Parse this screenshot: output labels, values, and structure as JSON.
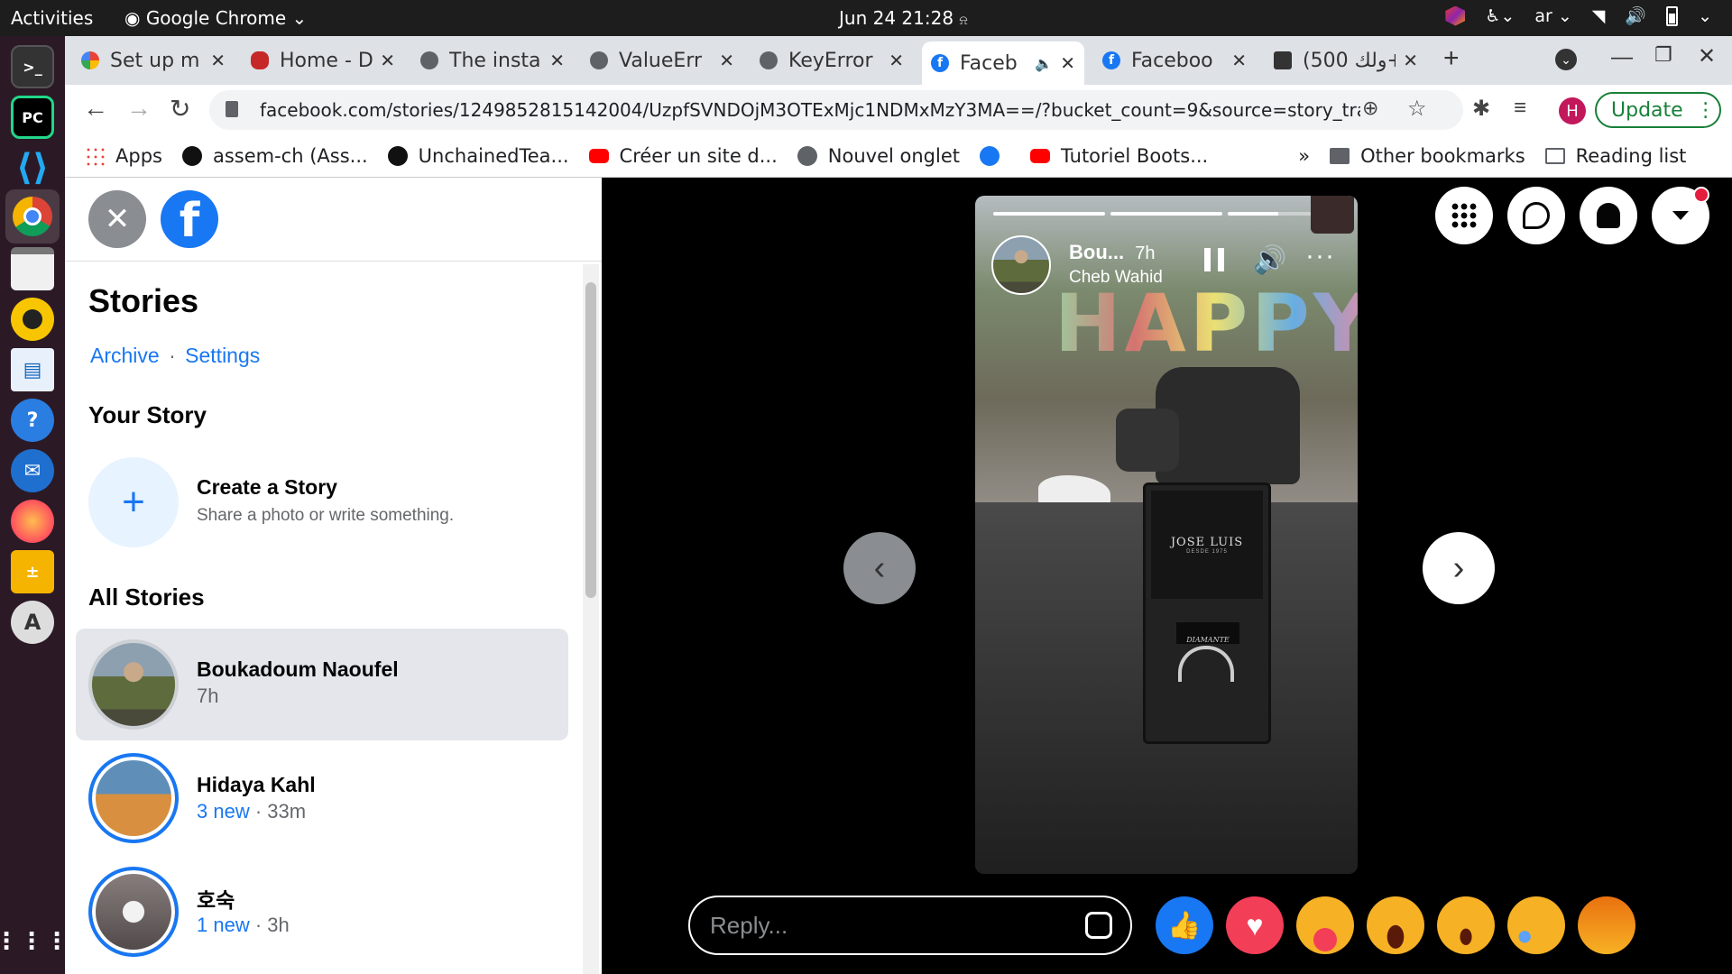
{
  "os": {
    "activities": "Activities",
    "app_name": "Google Chrome",
    "clock": "Jun 24  21:28",
    "lang": "ar"
  },
  "tabs": [
    {
      "title": "Set up m",
      "active": false
    },
    {
      "title": "Home - D",
      "active": false
    },
    {
      "title": "The insta",
      "active": false
    },
    {
      "title": "ValueErr",
      "active": false
    },
    {
      "title": "KeyError",
      "active": false
    },
    {
      "title": "Faceb",
      "active": true
    },
    {
      "title": "Faceboo",
      "active": false
    },
    {
      "title": "(ولك 500+",
      "active": false
    }
  ],
  "toolbar": {
    "url": "facebook.com/stories/1249852815142004/UzpfSVNDOjM3OTExMjc1NDMxMzY3MA==/?bucket_count=9&source=story_tray",
    "profile_initial": "H",
    "update_label": "Update"
  },
  "bookmarks": [
    {
      "label": "Apps",
      "icon": "apps-grid-icon"
    },
    {
      "label": "assem-ch (Ass...",
      "icon": "github-icon"
    },
    {
      "label": "UnchainedTea...",
      "icon": "github-icon"
    },
    {
      "label": "Créer un site d...",
      "icon": "youtube-icon"
    },
    {
      "label": "Nouvel onglet",
      "icon": "globe-icon"
    },
    {
      "label": "",
      "icon": "facebook-icon"
    },
    {
      "label": "Tutoriel Boots...",
      "icon": "youtube-icon"
    }
  ],
  "bookmarks_more": "»",
  "other_bookmarks": "Other bookmarks",
  "reading_list": "Reading list",
  "sidebar": {
    "title": "Stories",
    "archive": "Archive",
    "dot": "·",
    "settings": "Settings",
    "your_story": "Your Story",
    "create_title": "Create a Story",
    "create_sub": "Share a photo or write something.",
    "all_stories": "All Stories",
    "stories": [
      {
        "name": "Boukadoum Naoufel",
        "new": "",
        "time": "7h",
        "selected": true
      },
      {
        "name": "Hidaya Kahl",
        "new": "3 new",
        "time": "33m",
        "selected": false
      },
      {
        "name": "호숙",
        "new": "1 new",
        "time": "3h",
        "selected": false
      }
    ]
  },
  "story": {
    "author_short": "Bou...",
    "time": "7h",
    "music": "Cheb Wahid",
    "overlay_text": "HAPPY",
    "box_brand": "JOSE LUIS",
    "box_brand_sub": "DESDE 1975",
    "ring_tag": "DIAMANTE",
    "progress": [
      1,
      1,
      0.45
    ]
  },
  "reply_placeholder": "Reply...",
  "reactions": [
    "like",
    "love",
    "care",
    "haha",
    "wow",
    "sad",
    "angry"
  ],
  "colors": {
    "fb_blue": "#1877f2",
    "chrome_bg": "#dee1e6",
    "dock_bg": "#2b1a26"
  }
}
